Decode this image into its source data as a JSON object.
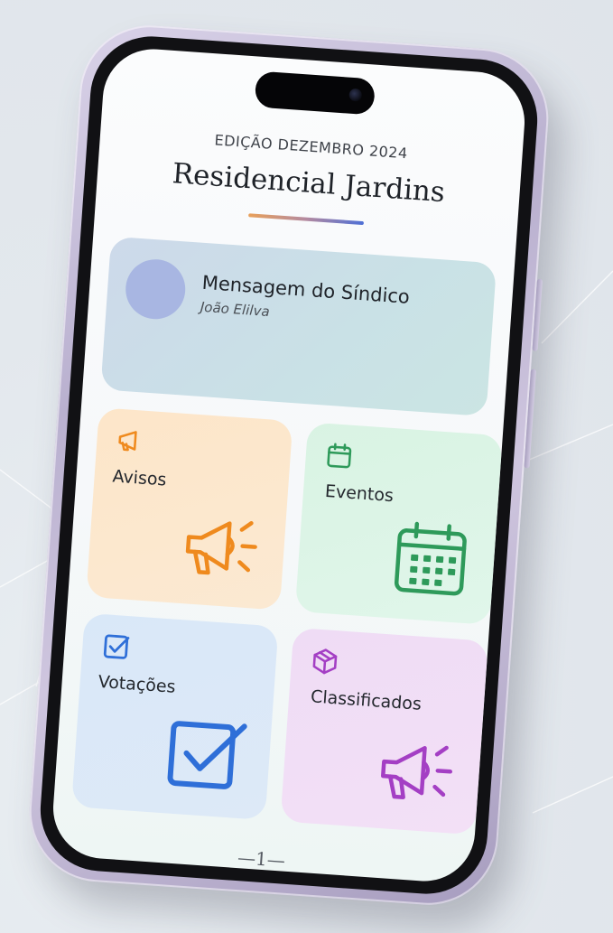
{
  "header": {
    "edition": "EDIÇÃO DEZEMBRO 2024",
    "title": "Residencial Jardins"
  },
  "message_card": {
    "title": "Mensagem do Síndico",
    "author": "João Elilva"
  },
  "tiles": [
    {
      "label": "Avisos",
      "icon": "megaphone-icon",
      "color": "#ef8a1e"
    },
    {
      "label": "Eventos",
      "icon": "calendar-icon",
      "color": "#2e9a5a"
    },
    {
      "label": "Votações",
      "icon": "checkbox-icon",
      "color": "#2f6fd8"
    },
    {
      "label": "Classificados",
      "icon": "package-icon",
      "color": "#a43fc4"
    }
  ],
  "footer": {
    "page": "—1—"
  },
  "colors": {
    "avisos_bg": "#fde6c9",
    "eventos_bg": "#d9f3e3",
    "votacoes_bg": "#d9e8f8",
    "classificados_bg": "#efdcf5",
    "message_bg": "#c9e1e6",
    "avatar": "#a8b6e2"
  }
}
